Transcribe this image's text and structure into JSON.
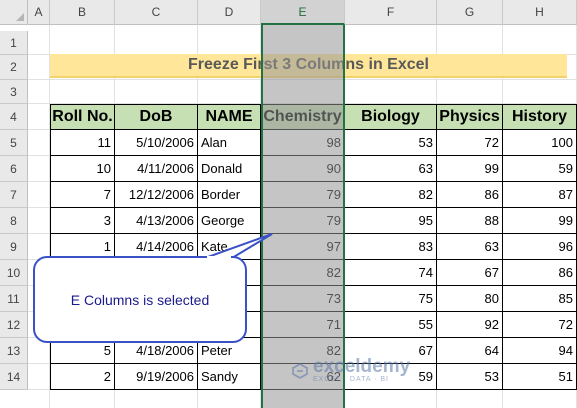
{
  "columns": [
    "A",
    "B",
    "C",
    "D",
    "E",
    "F",
    "G",
    "H"
  ],
  "rows": [
    "1",
    "2",
    "3",
    "4",
    "5",
    "6",
    "7",
    "8",
    "9",
    "10",
    "11",
    "12",
    "13",
    "14"
  ],
  "title": "Freeze First 3 Columns in Excel",
  "headers": [
    "Roll No.",
    "DoB",
    "NAME",
    "Chemistry",
    "Biology",
    "Physics",
    "History"
  ],
  "records": [
    {
      "roll": "11",
      "dob": "5/10/2006",
      "name": "Alan",
      "chem": "98",
      "bio": "53",
      "phy": "72",
      "hist": "100"
    },
    {
      "roll": "10",
      "dob": "4/11/2006",
      "name": "Donald",
      "chem": "90",
      "bio": "63",
      "phy": "99",
      "hist": "59"
    },
    {
      "roll": "7",
      "dob": "12/12/2006",
      "name": "Border",
      "chem": "79",
      "bio": "82",
      "phy": "86",
      "hist": "87"
    },
    {
      "roll": "3",
      "dob": "4/13/2006",
      "name": "George",
      "chem": "79",
      "bio": "95",
      "phy": "88",
      "hist": "99"
    },
    {
      "roll": "1",
      "dob": "4/14/2006",
      "name": "Kate",
      "chem": "97",
      "bio": "83",
      "phy": "63",
      "hist": "96"
    },
    {
      "roll": "",
      "dob": "",
      "name": "",
      "chem": "82",
      "bio": "74",
      "phy": "67",
      "hist": "86"
    },
    {
      "roll": "",
      "dob": "",
      "name": "",
      "chem": "73",
      "bio": "75",
      "phy": "80",
      "hist": "85"
    },
    {
      "roll": "",
      "dob": "",
      "name": "",
      "chem": "71",
      "bio": "55",
      "phy": "92",
      "hist": "72"
    },
    {
      "roll": "5",
      "dob": "4/18/2006",
      "name": "Peter",
      "chem": "82",
      "bio": "67",
      "phy": "64",
      "hist": "94"
    },
    {
      "roll": "2",
      "dob": "9/19/2006",
      "name": "Sandy",
      "chem": "62",
      "bio": "59",
      "phy": "53",
      "hist": "51"
    }
  ],
  "callout": {
    "text": "E Columns is selected"
  },
  "watermark": {
    "brand": "exceldemy",
    "tagline": "EXCEL · DATA · BI"
  },
  "colors": {
    "title_fill": "#ffe699",
    "header_fill": "#c6e0b4",
    "selection_border": "#217346",
    "callout_border": "#3a52c6"
  },
  "selected_column": "E"
}
